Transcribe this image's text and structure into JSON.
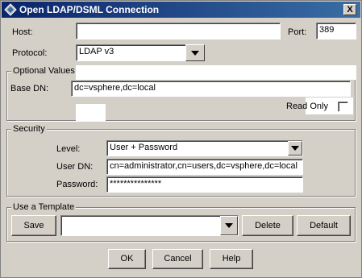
{
  "window": {
    "title": "Open LDAP/DSML Connection",
    "close_label": "X"
  },
  "host": {
    "label": "Host:",
    "value": ""
  },
  "port": {
    "label": "Port:",
    "value": "389"
  },
  "protocol": {
    "label": "Protocol:",
    "value": "LDAP v3"
  },
  "optional": {
    "group_label": "Optional Values",
    "base_dn_label": "Base DN:",
    "base_dn_value": "dc=vsphere,dc=local",
    "read_only_label": "Read Only",
    "read_only_checked": false
  },
  "security": {
    "group_label": "Security",
    "level_label": "Level:",
    "level_value": "User + Password",
    "user_dn_label": "User DN:",
    "user_dn_value": "cn=administrator,cn=users,dc=vsphere,dc=local",
    "password_label": "Password:",
    "password_value": "***************"
  },
  "template": {
    "group_label": "Use a Template",
    "save_label": "Save",
    "selected": "",
    "delete_label": "Delete",
    "default_label": "Default"
  },
  "footer": {
    "ok_label": "OK",
    "cancel_label": "Cancel",
    "help_label": "Help"
  }
}
